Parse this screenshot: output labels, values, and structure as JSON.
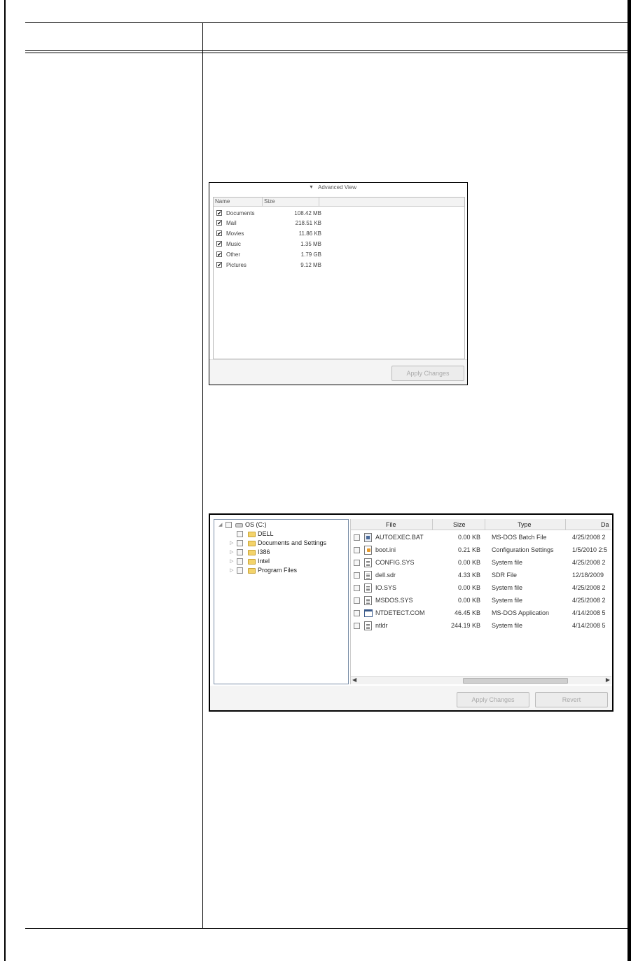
{
  "advanced_view": {
    "title": "Advanced View",
    "col_name": "Name",
    "col_size": "Size",
    "items": [
      {
        "name": "Documents",
        "size": "108.42 MB"
      },
      {
        "name": "Mail",
        "size": "218.51 KB"
      },
      {
        "name": "Movies",
        "size": "11.86 KB"
      },
      {
        "name": "Music",
        "size": "1.35 MB"
      },
      {
        "name": "Other",
        "size": "1.79 GB"
      },
      {
        "name": "Pictures",
        "size": "9.12 MB"
      }
    ],
    "apply_label": "Apply Changes"
  },
  "explorer": {
    "tree": [
      {
        "label": "OS (C:)"
      },
      {
        "label": "DELL"
      },
      {
        "label": "Documents and Settings"
      },
      {
        "label": "I386"
      },
      {
        "label": "Intel"
      },
      {
        "label": "Program Files"
      }
    ],
    "columns": {
      "file": "File",
      "size": "Size",
      "type": "Type",
      "date": "Da"
    },
    "files": [
      {
        "name": "AUTOEXEC.BAT",
        "size": "0.00 KB",
        "type": "MS-DOS Batch File",
        "date": "4/25/2008 2"
      },
      {
        "name": "boot.ini",
        "size": "0.21 KB",
        "type": "Configuration Settings",
        "date": "1/5/2010 2:5"
      },
      {
        "name": "CONFIG.SYS",
        "size": "0.00 KB",
        "type": "System file",
        "date": "4/25/2008 2"
      },
      {
        "name": "dell.sdr",
        "size": "4.33 KB",
        "type": "SDR File",
        "date": "12/18/2009"
      },
      {
        "name": "IO.SYS",
        "size": "0.00 KB",
        "type": "System file",
        "date": "4/25/2008 2"
      },
      {
        "name": "MSDOS.SYS",
        "size": "0.00 KB",
        "type": "System file",
        "date": "4/25/2008 2"
      },
      {
        "name": "NTDETECT.COM",
        "size": "46.45 KB",
        "type": "MS-DOS Application",
        "date": "4/14/2008 5"
      },
      {
        "name": "ntldr",
        "size": "244.19 KB",
        "type": "System file",
        "date": "4/14/2008 5"
      }
    ],
    "apply_label": "Apply Changes",
    "revert_label": "Revert"
  }
}
